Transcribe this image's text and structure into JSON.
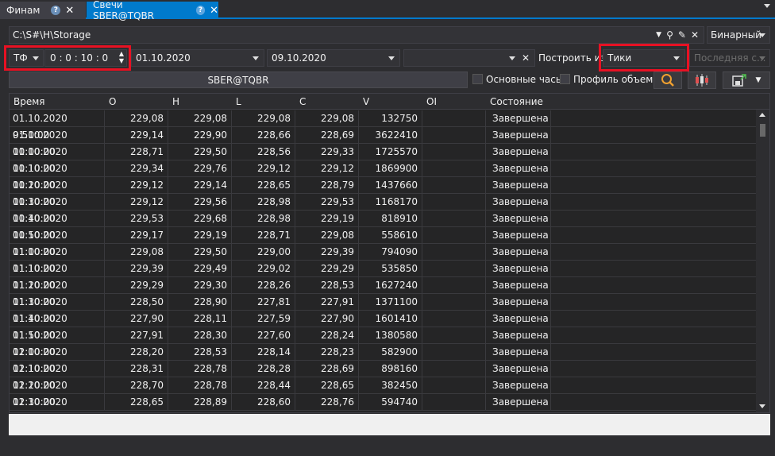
{
  "tabs": [
    {
      "label": "Финам"
    },
    {
      "label": "Свечи SBER@TQBR"
    }
  ],
  "toolbar": {
    "path": "C:\\S#\\H\\Storage",
    "format": "Бинарный",
    "tf_label": "ТФ",
    "timeframe": "0 : 0 : 10 : 0",
    "date_from": "01.10.2020",
    "date_to": "09.10.2020",
    "build_from_label": "Построить из:",
    "build_from": "Тики",
    "last_candle": "Последняя с...",
    "security": "SBER@TQBR",
    "main_hours_label": "Основные часы",
    "volume_profile_label": "Профиль объема"
  },
  "columns": [
    "Время",
    "O",
    "H",
    "L",
    "C",
    "V",
    "OI",
    "Состояние"
  ],
  "rows": [
    [
      "01.10.2020 9:50:00",
      "229,08",
      "229,08",
      "229,08",
      "229,08",
      "132750",
      "",
      "Завершена"
    ],
    [
      "01.10.2020 10:00:00",
      "229,14",
      "229,90",
      "228,66",
      "228,69",
      "3622410",
      "",
      "Завершена"
    ],
    [
      "01.10.2020 10:10:00",
      "228,71",
      "229,50",
      "228,56",
      "229,33",
      "1725570",
      "",
      "Завершена"
    ],
    [
      "01.10.2020 10:20:00",
      "229,34",
      "229,76",
      "229,12",
      "229,12",
      "1869900",
      "",
      "Завершена"
    ],
    [
      "01.10.2020 10:30:00",
      "229,12",
      "229,14",
      "228,65",
      "228,79",
      "1437660",
      "",
      "Завершена"
    ],
    [
      "01.10.2020 10:40:00",
      "229,12",
      "229,56",
      "228,98",
      "229,53",
      "1168170",
      "",
      "Завершена"
    ],
    [
      "01.10.2020 10:50:00",
      "229,53",
      "229,68",
      "228,98",
      "229,19",
      "818910",
      "",
      "Завершена"
    ],
    [
      "01.10.2020 11:00:00",
      "229,17",
      "229,19",
      "228,71",
      "229,08",
      "558610",
      "",
      "Завершена"
    ],
    [
      "01.10.2020 11:10:00",
      "229,08",
      "229,50",
      "229,00",
      "229,39",
      "794090",
      "",
      "Завершена"
    ],
    [
      "01.10.2020 11:20:00",
      "229,39",
      "229,49",
      "229,02",
      "229,29",
      "535850",
      "",
      "Завершена"
    ],
    [
      "01.10.2020 11:30:00",
      "229,29",
      "229,30",
      "228,26",
      "228,53",
      "1627240",
      "",
      "Завершена"
    ],
    [
      "01.10.2020 11:40:00",
      "228,50",
      "228,90",
      "227,81",
      "227,91",
      "1371100",
      "",
      "Завершена"
    ],
    [
      "01.10.2020 11:50:00",
      "227,90",
      "228,11",
      "227,59",
      "227,90",
      "1601410",
      "",
      "Завершена"
    ],
    [
      "01.10.2020 12:00:00",
      "227,91",
      "228,30",
      "227,60",
      "228,24",
      "1380580",
      "",
      "Завершена"
    ],
    [
      "01.10.2020 12:10:00",
      "228,20",
      "228,53",
      "228,14",
      "228,23",
      "582900",
      "",
      "Завершена"
    ],
    [
      "01.10.2020 12:20:00",
      "228,31",
      "228,78",
      "228,28",
      "228,69",
      "898160",
      "",
      "Завершена"
    ],
    [
      "01.10.2020 12:30:00",
      "228,70",
      "228,78",
      "228,44",
      "228,65",
      "382450",
      "",
      "Завершена"
    ],
    [
      "01.10.2020 12:40:00",
      "228,65",
      "228,89",
      "228,60",
      "228,76",
      "594740",
      "",
      "Завершена"
    ]
  ],
  "colors": {
    "accent": "#007acc",
    "highlight": "#e81123",
    "search_icon": "#f0a030"
  }
}
